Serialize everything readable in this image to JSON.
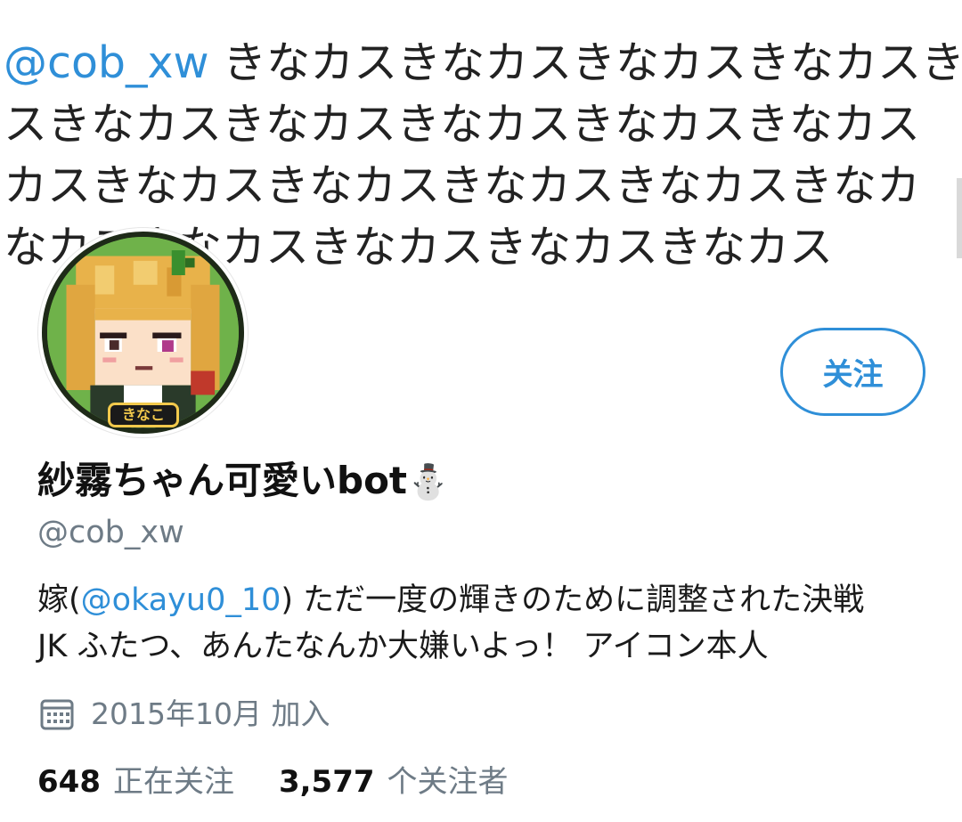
{
  "banner": {
    "mention": "@cob_xw",
    "line1_rest": " きなカスきなカスきなカスきなカスき",
    "line2": "スきなカスきなカスきなカスきなカスきなカス",
    "line3": "カスきなカスきなカスきなカスきなカスきなカ",
    "line4": "なカスきなカスきなカスきなカスきなカス"
  },
  "avatar": {
    "label": "きなこ"
  },
  "follow_button": {
    "label": "关注"
  },
  "profile": {
    "display_name": "紗霧ちゃん可愛いbot",
    "name_emoji": "⛄",
    "handle": "@cob_xw",
    "bio": {
      "prefix": "嫁(",
      "mention": "@okayu0_10",
      "line1_rest": ") ただ一度の輝きのために調整された決戦",
      "line2": "JK ふたつ、あんたなんか大嫌いよっ！ アイコン本人"
    },
    "joined": "2015年10月 加入"
  },
  "stats": {
    "following_count": "648",
    "following_label": "正在关注",
    "followers_count": "3,577",
    "followers_label": "个关注者"
  },
  "icons": {
    "calendar": "calendar-icon",
    "snowman": "snowman-icon"
  },
  "colors": {
    "accent": "#2f8fd8",
    "muted": "#6e7b86"
  }
}
